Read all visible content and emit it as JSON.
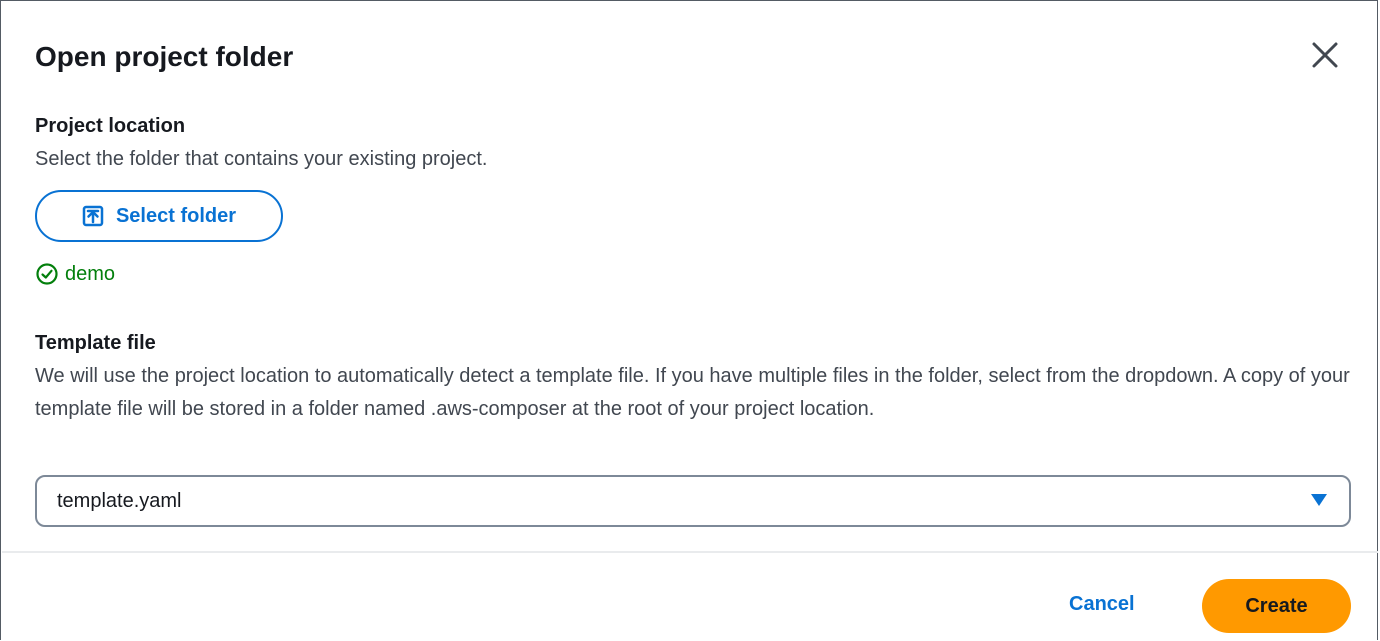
{
  "dialog": {
    "title": "Open project folder",
    "close_icon": "close-icon"
  },
  "project_location": {
    "title": "Project location",
    "description": "Select the folder that contains your existing project.",
    "button_label": "Select folder",
    "button_icon": "upload-folder-icon",
    "status_icon": "check-circle-icon",
    "selected_folder": "demo"
  },
  "template_file": {
    "title": "Template file",
    "description": "We will use the project location to automatically detect a template file. If you have multiple files in the folder, select from the dropdown. A copy of your template file will be stored in a folder named .aws-composer at the root of your project location.",
    "selected_value": "template.yaml",
    "caret_icon": "caret-down-icon"
  },
  "footer": {
    "cancel_label": "Cancel",
    "create_label": "Create"
  },
  "colors": {
    "primary_link": "#0972d3",
    "success": "#037f0c",
    "primary_button": "#ff9900",
    "text": "#16191f"
  }
}
